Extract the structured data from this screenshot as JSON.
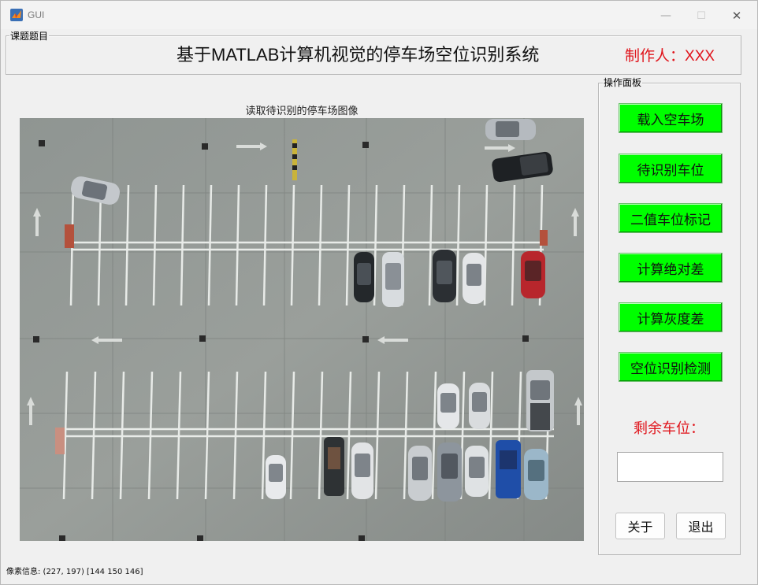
{
  "window": {
    "title": "GUI",
    "controls": {
      "minimize": "—",
      "maximize": "☐",
      "close": "✕"
    }
  },
  "header_panel": {
    "legend": "课题题目",
    "title": "基于MATLAB计算机视觉的停车场空位识别系统",
    "author_label": "制作人：",
    "author_name": "XXX"
  },
  "image_area": {
    "caption": "读取待识别的停车场图像",
    "image_description_icon": "parking-lot-photo"
  },
  "control_panel": {
    "legend": "操作面板",
    "buttons": [
      "载入空车场",
      "待识别车位",
      "二值车位标记",
      "计算绝对差",
      "计算灰度差",
      "空位识别检测"
    ],
    "remaining_label": "剩余车位：",
    "remaining_value": "",
    "about": "关于",
    "exit": "退出"
  },
  "status_bar": {
    "text": "像素信息: (227, 197)  [144 150 146]"
  },
  "colors": {
    "button_green": "#00ff00",
    "accent_red": "#e0141b",
    "background": "#f0f0f0"
  }
}
